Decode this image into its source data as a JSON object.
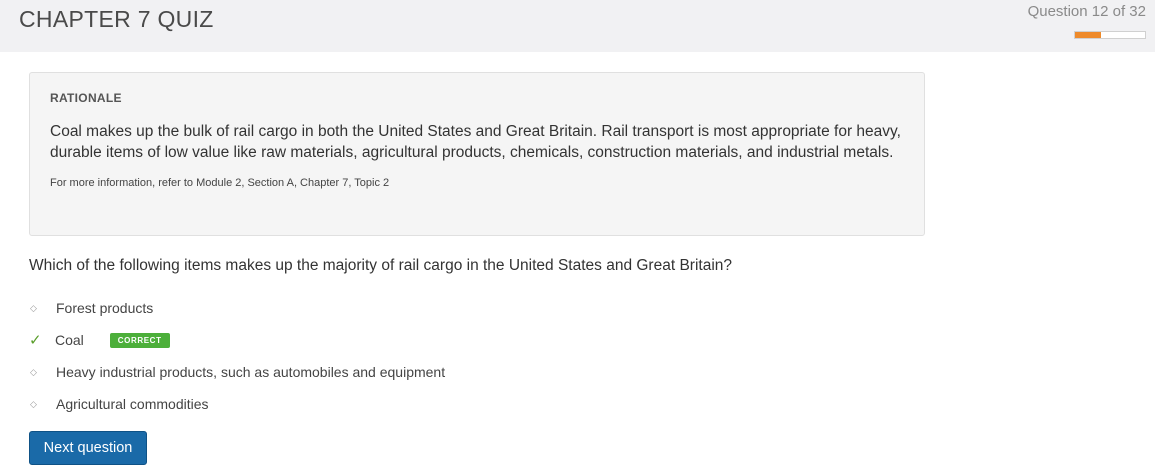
{
  "header": {
    "title": "CHAPTER 7 QUIZ",
    "progress_text": "Question 12 of 32",
    "progress_fraction": 0.375,
    "progress_color": "#ee8a2a"
  },
  "rationale": {
    "heading": "RATIONALE",
    "body": "Coal makes up the bulk of rail cargo in both the United States and Great Britain. Rail transport is most appropriate for heavy, durable items of low value like raw materials, agricultural products, chemicals, construction materials, and industrial metals.",
    "reference": "For more information, refer to Module 2, Section A, Chapter 7, Topic 2"
  },
  "question": {
    "text": "Which of the following items makes up the majority of rail cargo in the United States and Great Britain?",
    "answers": [
      {
        "label": "Forest products",
        "marker_icon": "bullet-icon",
        "correct": false
      },
      {
        "label": "Coal",
        "marker_icon": "checkmark-icon",
        "correct": true,
        "badge": "CORRECT"
      },
      {
        "label": "Heavy industrial products, such as automobiles and equipment",
        "marker_icon": "bullet-icon",
        "correct": false
      },
      {
        "label": "Agricultural commodities",
        "marker_icon": "bullet-icon",
        "correct": false
      }
    ]
  },
  "actions": {
    "next_label": "Next question",
    "next_color": "#1a6aa8"
  },
  "colors": {
    "header_bg": "#f1f1f3",
    "correct_green": "#4caf3a"
  }
}
